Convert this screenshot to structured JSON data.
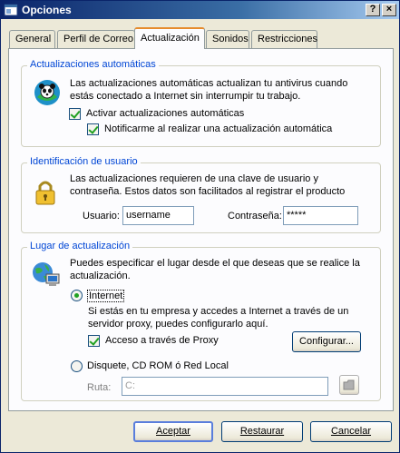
{
  "window": {
    "title": "Opciones",
    "help_label": "?",
    "close_label": "×",
    "icon": "app-window-icon"
  },
  "tabs": [
    {
      "label": "General",
      "active": false
    },
    {
      "label": "Perfil de Correo",
      "active": false
    },
    {
      "label": "Actualización",
      "active": true
    },
    {
      "label": "Sonidos",
      "active": false
    },
    {
      "label": "Restricciones",
      "active": false
    }
  ],
  "auto_updates": {
    "title": "Actualizaciones automáticas",
    "description_line1": "Las actualizaciones automáticas actualizan tu antivirus cuando",
    "description_line2": "estás conectado a Internet sin interrumpir tu trabajo.",
    "activate_label": "Activar actualizaciones automáticas",
    "activate_checked": true,
    "notify_label": "Notificarme al realizar una actualización automática",
    "notify_checked": true,
    "icon": "panda-icon"
  },
  "user_id": {
    "title": "Identificación de usuario",
    "description_line1": "Las actualizaciones requieren de una clave de usuario y",
    "description_line2": "contraseña. Estos datos son facilitados al registrar el producto",
    "user_label": "Usuario:",
    "user_value": "username",
    "password_label": "Contraseña:",
    "password_value": "*****",
    "icon": "lock-icon"
  },
  "update_location": {
    "title": "Lugar de actualización",
    "description_line1": "Puedes especificar el lugar desde el que deseas que se realice la",
    "description_line2": "actualización.",
    "internet_label": "Internet",
    "internet_selected": true,
    "internet_desc_line1": "Si estás en tu empresa y accedes a Internet a través de un",
    "internet_desc_line2": "servidor proxy, puedes configurarlo aquí.",
    "proxy_label": "Acceso a través de Proxy",
    "proxy_checked": true,
    "configure_label": "Configurar...",
    "disk_label": "Disquete, CD ROM ó Red Local",
    "disk_selected": false,
    "path_label": "Ruta:",
    "path_value": "C:",
    "icon": "globe-computer-icon",
    "browse_icon": "folder-icon"
  },
  "footer": {
    "accept_label": "Aceptar",
    "restore_label": "Restaurar",
    "cancel_label": "Cancelar"
  }
}
